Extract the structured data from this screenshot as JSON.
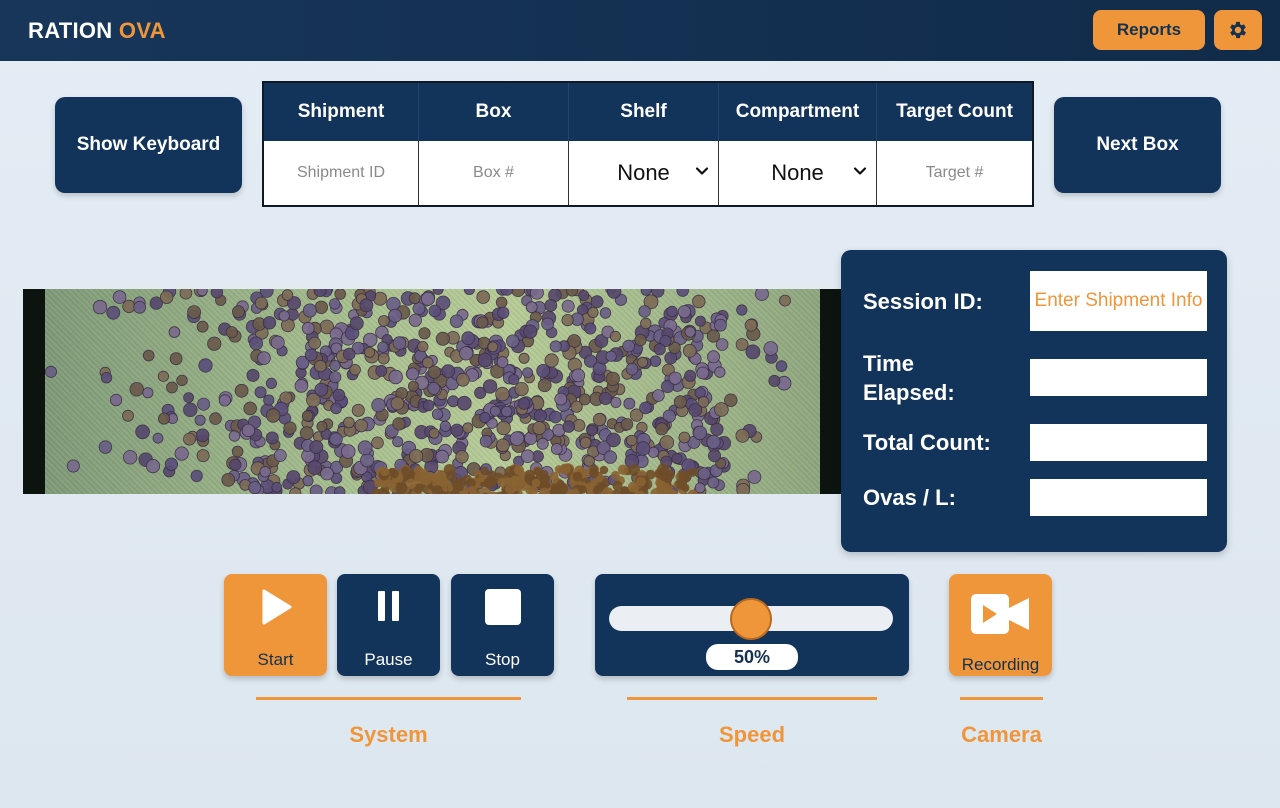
{
  "header": {
    "brand_part1": "RATION",
    "brand_part2": "OVA",
    "reports_label": "Reports",
    "settings_icon": "gear-icon"
  },
  "actions": {
    "show_keyboard_label": "Show Keyboard",
    "next_box_label": "Next Box"
  },
  "shipment_table": {
    "headers": [
      "Shipment",
      "Box",
      "Shelf",
      "Compartment",
      "Target Count"
    ],
    "shipment_placeholder": "Shipment ID",
    "box_placeholder": "Box #",
    "shelf_value": "None",
    "compartment_value": "None",
    "target_placeholder": "Target #"
  },
  "session": {
    "session_id_label": "Session ID:",
    "session_id_value": "Enter Shipment Info",
    "time_elapsed_label_1": "Time",
    "time_elapsed_label_2": "Elapsed:",
    "time_elapsed_value": "",
    "total_count_label": "Total Count:",
    "total_count_value": "",
    "ovas_per_l_label": "Ovas / L:",
    "ovas_per_l_value": ""
  },
  "controls": {
    "start_label": "Start",
    "pause_label": "Pause",
    "stop_label": "Stop",
    "speed_value_text": "50%",
    "speed_fraction": 0.5,
    "recording_label": "Recording",
    "group_system": "System",
    "group_speed": "Speed",
    "group_camera": "Camera"
  },
  "colors": {
    "navy": "#12345a",
    "orange": "#f0963a",
    "background": "#e4ecf4"
  }
}
